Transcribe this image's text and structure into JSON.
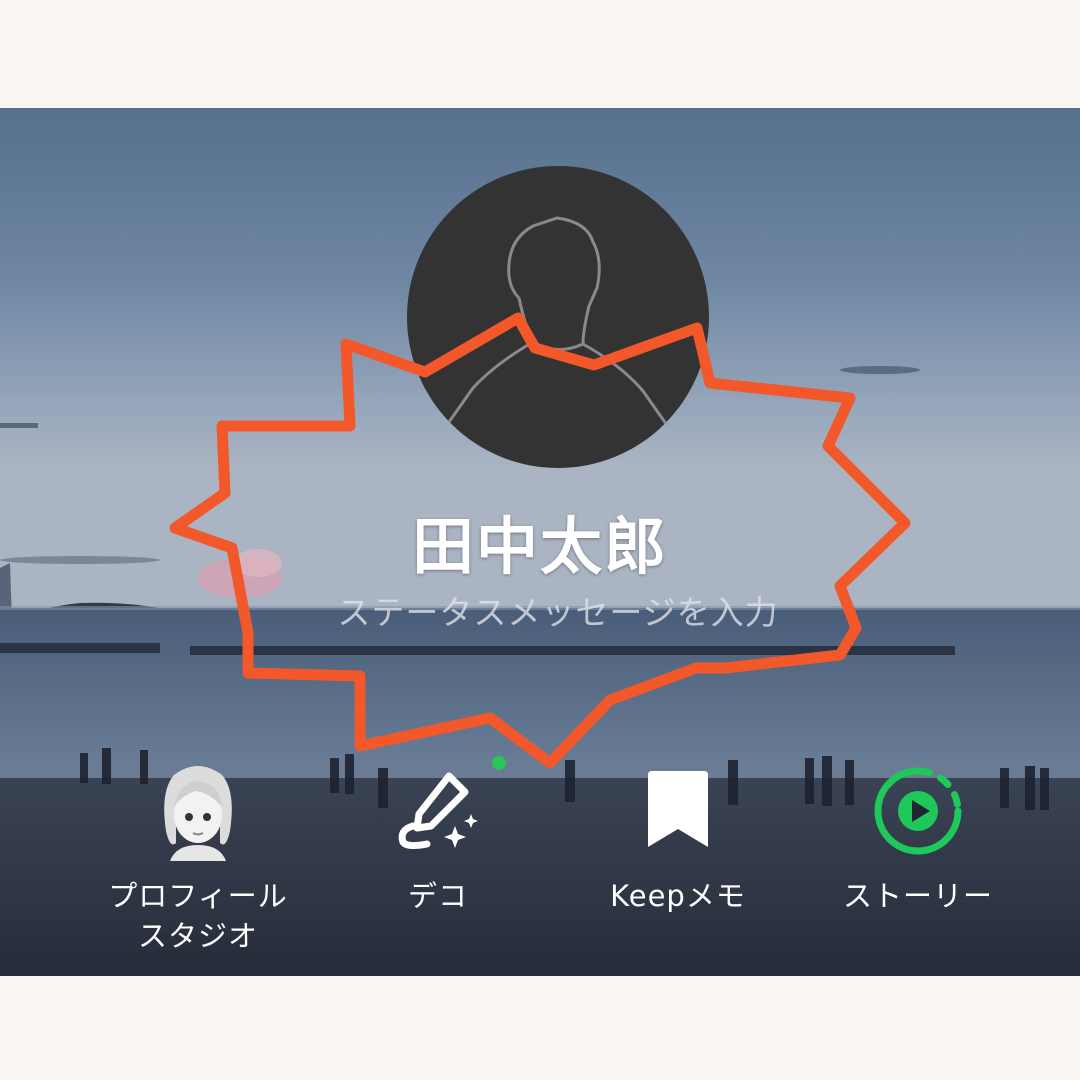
{
  "profile": {
    "name": "田中太郎",
    "status_placeholder": "ステータスメッセージを入力"
  },
  "actions": [
    {
      "id": "profile-studio",
      "label_line1": "プロフィール",
      "label_line2": "スタジオ",
      "icon": "avatar-girl-icon"
    },
    {
      "id": "deco",
      "label_line1": "デコ",
      "icon": "magic-pen-icon",
      "has_new_badge": true
    },
    {
      "id": "keep-memo",
      "label_line1": "Keepメモ",
      "icon": "bookmark-icon"
    },
    {
      "id": "story",
      "label_line1": "ストーリー",
      "icon": "story-play-icon"
    }
  ],
  "colors": {
    "burst_outline": "#f2582a",
    "story_ring": "#1ec85a",
    "new_badge": "#2bc458",
    "avatar_bg": "#333333"
  }
}
